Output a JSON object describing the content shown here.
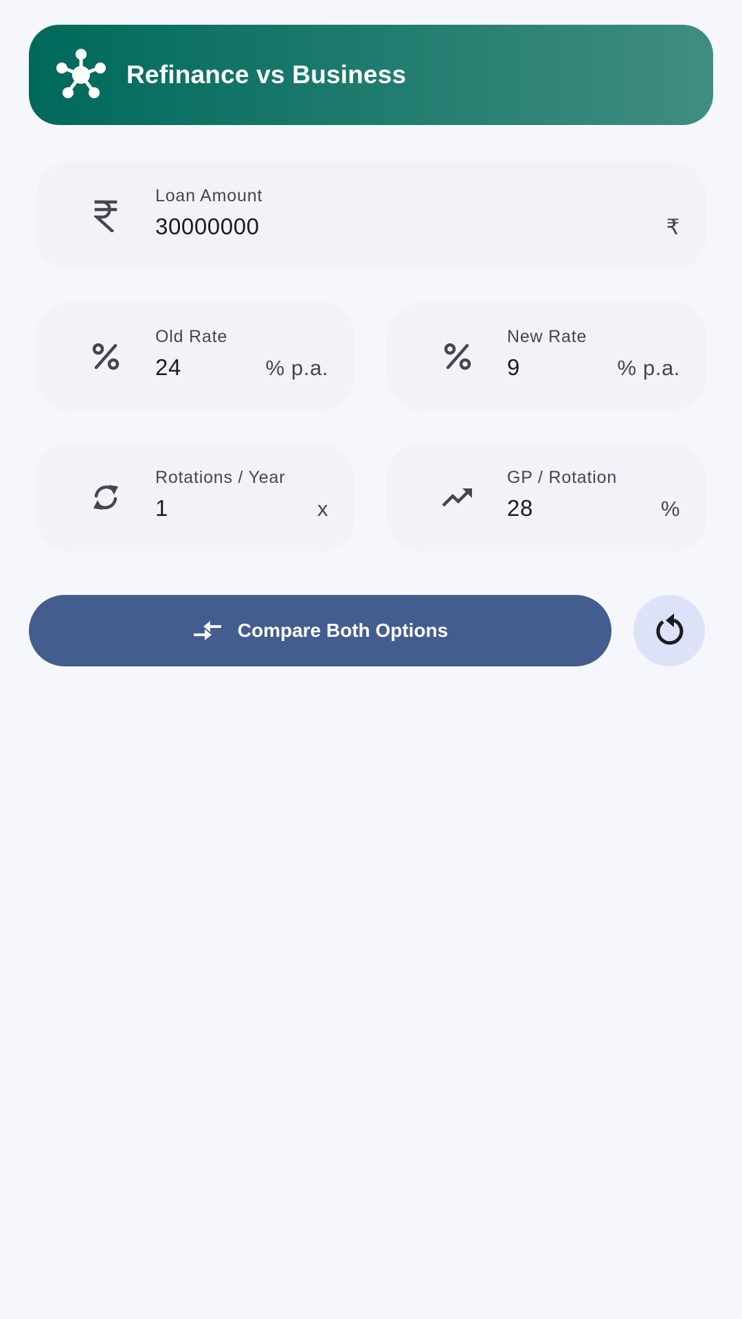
{
  "header": {
    "title": "Refinance vs Business",
    "icon": "hub-network-icon"
  },
  "colors": {
    "header_gradient_start": "#00695a",
    "header_gradient_end": "#418d81",
    "background": "#f6f7fc",
    "field_background": "#f1f3f9",
    "primary_button": "#435d8f",
    "reset_button": "#dde2f9"
  },
  "fields": {
    "loan_amount": {
      "label": "Loan Amount",
      "value": "30000000",
      "suffix": "₹",
      "icon": "rupee-icon"
    },
    "old_rate": {
      "label": "Old Rate",
      "value": "24",
      "suffix": "% p.a.",
      "icon": "percent-icon"
    },
    "new_rate": {
      "label": "New Rate",
      "value": "9",
      "suffix": "% p.a.",
      "icon": "percent-icon"
    },
    "rotations": {
      "label": "Rotations / Year",
      "value": "1",
      "suffix": "x",
      "icon": "sync-icon"
    },
    "gp_rotation": {
      "label": "GP / Rotation",
      "value": "28",
      "suffix": "%",
      "icon": "trending-up-icon"
    }
  },
  "actions": {
    "compare_label": "Compare Both Options",
    "compare_icon": "compare-arrows-icon",
    "reset_icon": "reset-icon"
  }
}
